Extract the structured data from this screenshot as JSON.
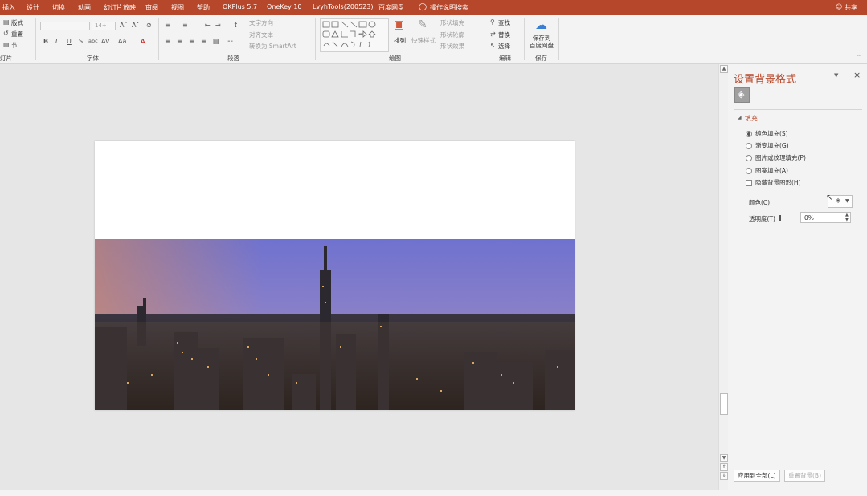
{
  "menu": {
    "items": [
      "插入",
      "设计",
      "切换",
      "动画",
      "幻灯片放映",
      "审阅",
      "视图",
      "帮助",
      "OKPlus 5.7",
      "OneKey 10",
      "LvyhTools(200523)",
      "百度网盘",
      "操作说明搜索"
    ],
    "share": "共享"
  },
  "ribbon": {
    "slides": {
      "layout": "版式",
      "reset": "重置",
      "section": "节",
      "label": "灯片"
    },
    "font": {
      "size": "14+",
      "label": "字体"
    },
    "paragraph": {
      "text_direction": "文字方向",
      "align_text": "对齐文本",
      "smartart": "转换为 SmartArt",
      "label": "段落"
    },
    "drawing": {
      "arrange": "排列",
      "quick_styles": "快速样式",
      "fill": "形状填充",
      "outline": "形状轮廓",
      "effects": "形状效果",
      "label": "绘图"
    },
    "editing": {
      "find": "查找",
      "replace": "替换",
      "select": "选择",
      "label": "编辑"
    },
    "save": {
      "button": "保存到\n百度网盘",
      "label": "保存"
    }
  },
  "pane": {
    "title": "设置背景格式",
    "section": "填充",
    "options": [
      {
        "label": "纯色填充(S)",
        "checked": true
      },
      {
        "label": "渐变填充(G)",
        "checked": false
      },
      {
        "label": "图片或纹理填充(P)",
        "checked": false
      },
      {
        "label": "图案填充(A)",
        "checked": false
      }
    ],
    "hide_graphics": "隐藏背景图形(H)",
    "color_label": "颜色(C)",
    "transparency_label": "透明度(T)",
    "transparency_value": "0%",
    "apply_all": "应用到全部(L)",
    "reset_bg": "重置背景(B)"
  },
  "colors": {
    "accent": "#b7472a"
  }
}
